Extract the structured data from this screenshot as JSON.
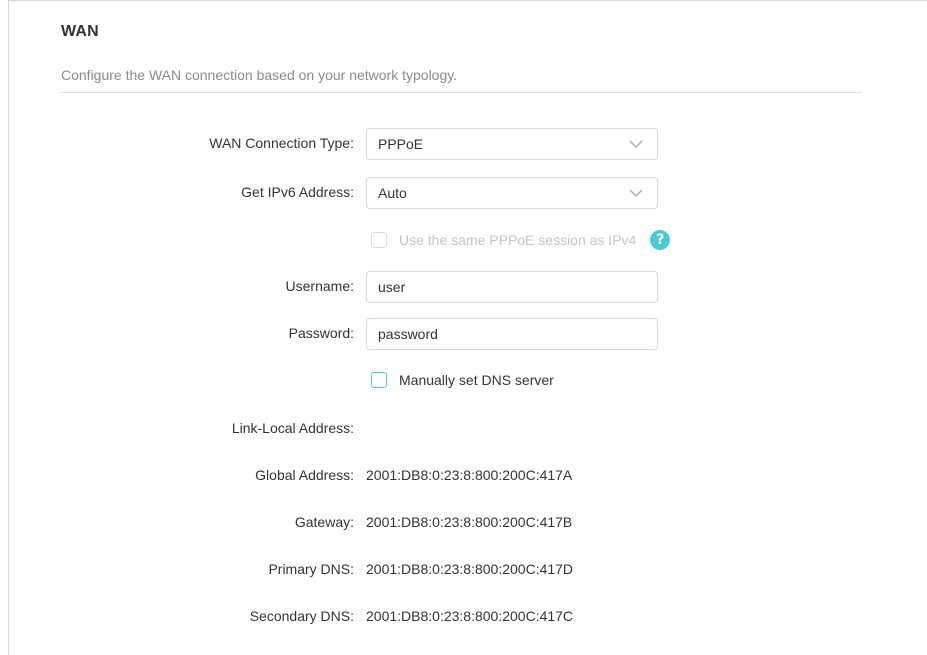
{
  "section": {
    "title": "WAN",
    "description": "Configure the WAN connection based on your network typology."
  },
  "form": {
    "connection_type": {
      "label": "WAN Connection Type:",
      "value": "PPPoE"
    },
    "ipv6_address": {
      "label": "Get IPv6 Address:",
      "value": "Auto"
    },
    "same_session": {
      "label": "Use the same PPPoE session as IPv4",
      "checked": false,
      "disabled": true,
      "help_icon": "?"
    },
    "username": {
      "label": "Username:",
      "value": "user"
    },
    "password": {
      "label": "Password:",
      "value": "password"
    },
    "manual_dns": {
      "label": "Manually set DNS server",
      "checked": false
    }
  },
  "status": {
    "link_local": {
      "label": "Link-Local Address:",
      "value": ""
    },
    "global_address": {
      "label": "Global Address:",
      "value": "2001:DB8:0:23:8:800:200C:417A"
    },
    "gateway": {
      "label": "Gateway:",
      "value": "2001:DB8:0:23:8:800:200C:417B"
    },
    "primary_dns": {
      "label": "Primary DNS:",
      "value": "2001:DB8:0:23:8:800:200C:417D"
    },
    "secondary_dns": {
      "label": "Secondary DNS:",
      "value": "2001:DB8:0:23:8:800:200C:417C"
    }
  },
  "colors": {
    "accent": "#4acbd6",
    "border": "#d9d9d9",
    "muted_text": "#8a8a8a",
    "disabled_text": "#c4c4c4"
  }
}
